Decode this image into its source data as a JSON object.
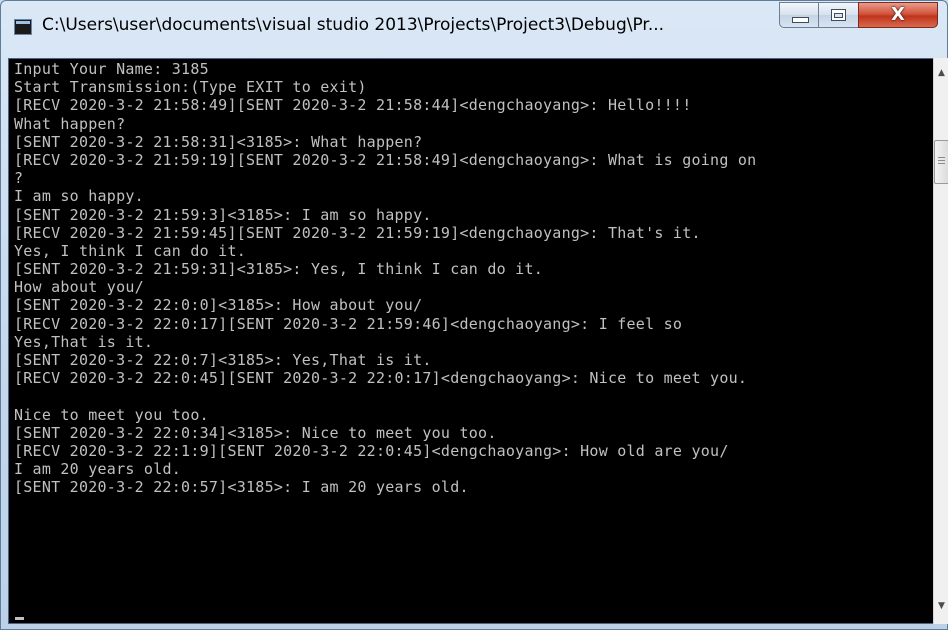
{
  "window": {
    "title": "C:\\Users\\user\\documents\\visual studio 2013\\Projects\\Project3\\Debug\\Pr...",
    "controls": {
      "minimize_icon": "minimize-icon",
      "maximize_icon": "maximize-icon",
      "close_glyph": "X"
    }
  },
  "console": {
    "lines": [
      "Input Your Name: 3185",
      "Start Transmission:(Type EXIT to exit)",
      "[RECV 2020-3-2 21:58:49][SENT 2020-3-2 21:58:44]<dengchaoyang>: Hello!!!!",
      "What happen?",
      "[SENT 2020-3-2 21:58:31]<3185>: What happen?",
      "[RECV 2020-3-2 21:59:19][SENT 2020-3-2 21:58:49]<dengchaoyang>: What is going on",
      "?",
      "I am so happy.",
      "[SENT 2020-3-2 21:59:3]<3185>: I am so happy.",
      "[RECV 2020-3-2 21:59:45][SENT 2020-3-2 21:59:19]<dengchaoyang>: That's it.",
      "Yes, I think I can do it.",
      "[SENT 2020-3-2 21:59:31]<3185>: Yes, I think I can do it.",
      "How about you/",
      "[SENT 2020-3-2 22:0:0]<3185>: How about you/",
      "[RECV 2020-3-2 22:0:17][SENT 2020-3-2 21:59:46]<dengchaoyang>: I feel so",
      "Yes,That is it.",
      "[SENT 2020-3-2 22:0:7]<3185>: Yes,That is it.",
      "[RECV 2020-3-2 22:0:45][SENT 2020-3-2 22:0:17]<dengchaoyang>: Nice to meet you.",
      "",
      "Nice to meet you too.",
      "[SENT 2020-3-2 22:0:34]<3185>: Nice to meet you too.",
      "[RECV 2020-3-2 22:1:9][SENT 2020-3-2 22:0:45]<dengchaoyang>: How old are you/",
      "I am 20 years old.",
      "[SENT 2020-3-2 22:0:57]<3185>: I am 20 years old."
    ]
  },
  "scrollbar": {
    "up_icon": "▲",
    "down_icon": "▼",
    "position_fraction": 0.12
  },
  "colors": {
    "console_background": "#000000",
    "console_text": "#c0c0c0",
    "close_button": "#c7422a",
    "frame": "#c4d7ec"
  }
}
